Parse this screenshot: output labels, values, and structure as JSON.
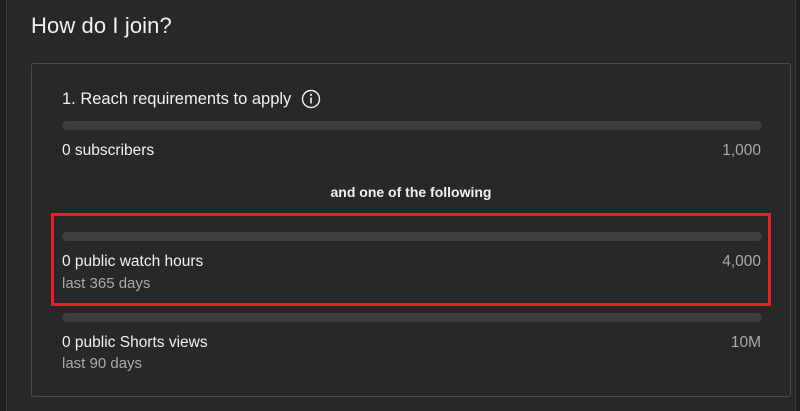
{
  "section_heading": "How do I join?",
  "step": {
    "title": "1. Reach requirements to apply",
    "info_icon": "info-circle-icon"
  },
  "requirements": [
    {
      "label": "0 subscribers",
      "target": "1,000",
      "progress": 0
    }
  ],
  "divider": "and one of the following",
  "alternatives": [
    {
      "label": "0 public watch hours",
      "target": "4,000",
      "period": "last 365 days",
      "progress": 0,
      "highlighted": true
    },
    {
      "label": "0 public Shorts views",
      "target": "10M",
      "period": "last 90 days",
      "progress": 0,
      "highlighted": false
    }
  ],
  "colors": {
    "highlight": "#e8202a",
    "progress_fill": "#3ea6ff",
    "track": "#3d3d3d"
  }
}
